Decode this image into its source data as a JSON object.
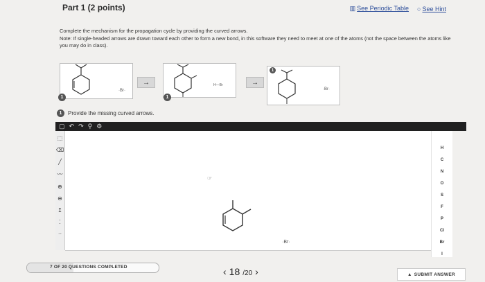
{
  "header": {
    "title": "Part 1  (2 points)",
    "periodic_table": "See Periodic Table",
    "hint": "See Hint"
  },
  "instructions": {
    "line1": "Complete the mechanism for the propagation cycle by providing the curved arrows.",
    "line2": "Note: If single-headed arrows are drawn toward each other to form a new bond, in this software they need to meet at one of the atoms (not the space between the atoms like you may do in class)."
  },
  "steps": {
    "badge1": "1",
    "badge2": "1",
    "badge3": "1",
    "arrow": "→"
  },
  "prompt": {
    "badge": "1",
    "text": "Provide the missing curved arrows."
  },
  "toolbar": {
    "icons": [
      "new-file-icon",
      "undo-icon",
      "redo-icon",
      "zoom-icon",
      "settings-icon"
    ]
  },
  "elements": [
    "H",
    "C",
    "N",
    "O",
    "S",
    "F",
    "P",
    "Cl",
    "Br",
    "I"
  ],
  "footer": {
    "progress_text": "7 OF 20 QUESTIONS COMPLETED",
    "progress_fraction": 0.35,
    "current": "18",
    "total": "/20",
    "prev": "‹",
    "next": "›",
    "submit": "SUBMIT ANSWER"
  },
  "colors": {
    "link": "#2c4d9a",
    "toolbar_bg": "#202020"
  }
}
